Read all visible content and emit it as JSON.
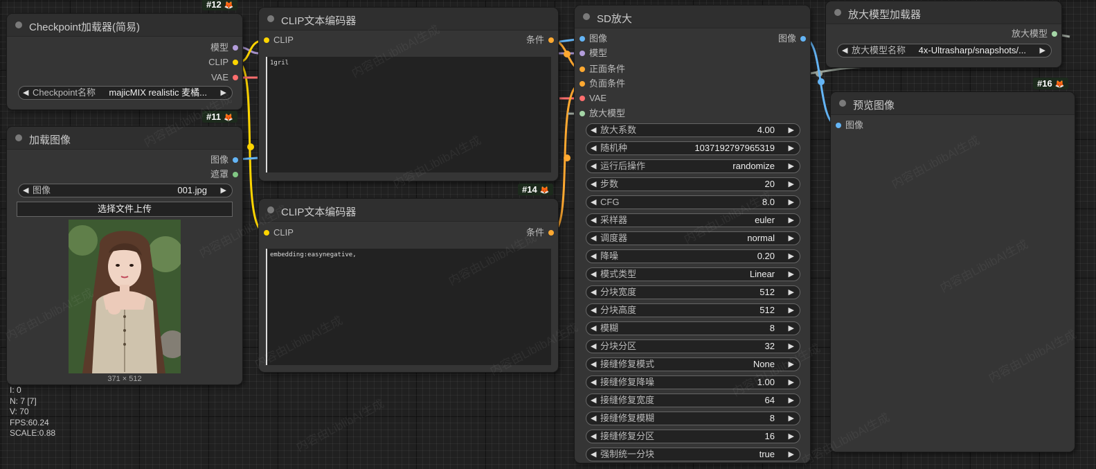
{
  "colors": {
    "model": "#b39ddb",
    "clip": "#ffd500",
    "vae": "#ff6e6e",
    "image": "#64b5f6",
    "mask": "#81c784",
    "conditioning": "#ffa931",
    "upscale_model": "#a5d6a7"
  },
  "badges": {
    "n12": "#12",
    "n11": "#11",
    "n14": "#14",
    "n16": "#16"
  },
  "checkpoint": {
    "title": "Checkpoint加载器(简易)",
    "outputs": [
      "模型",
      "CLIP",
      "VAE"
    ],
    "ckpt_label": "Checkpoint名称",
    "ckpt_value": "majicMIX realistic 麦橘..."
  },
  "load_image": {
    "title": "加载图像",
    "outputs": [
      "图像",
      "遮罩"
    ],
    "image_label": "图像",
    "image_value": "001.jpg",
    "upload_label": "选择文件上传",
    "dims": "371 × 512"
  },
  "clip_pos": {
    "title": "CLIP文本编码器",
    "input": "CLIP",
    "output": "条件",
    "text": "1gril"
  },
  "clip_neg": {
    "title": "CLIP文本编码器",
    "input": "CLIP",
    "output": "条件",
    "text": "embedding:easynegative,"
  },
  "sd_upscale": {
    "title": "SD放大",
    "inputs": [
      "图像",
      "模型",
      "正面条件",
      "负面条件",
      "VAE",
      "放大模型"
    ],
    "output": "图像",
    "widgets": [
      {
        "label": "放大系数",
        "value": "4.00"
      },
      {
        "label": "随机种",
        "value": "1037192797965319"
      },
      {
        "label": "运行后操作",
        "value": "randomize"
      },
      {
        "label": "步数",
        "value": "20"
      },
      {
        "label": "CFG",
        "value": "8.0"
      },
      {
        "label": "采样器",
        "value": "euler"
      },
      {
        "label": "调度器",
        "value": "normal"
      },
      {
        "label": "降噪",
        "value": "0.20"
      },
      {
        "label": "模式类型",
        "value": "Linear"
      },
      {
        "label": "分块宽度",
        "value": "512"
      },
      {
        "label": "分块高度",
        "value": "512"
      },
      {
        "label": "模糊",
        "value": "8"
      },
      {
        "label": "分块分区",
        "value": "32"
      },
      {
        "label": "接缝修复模式",
        "value": "None"
      },
      {
        "label": "接缝修复降噪",
        "value": "1.00"
      },
      {
        "label": "接缝修复宽度",
        "value": "64"
      },
      {
        "label": "接缝修复模糊",
        "value": "8"
      },
      {
        "label": "接缝修复分区",
        "value": "16"
      },
      {
        "label": "强制统一分块",
        "value": "true"
      }
    ]
  },
  "upscale_loader": {
    "title": "放大模型加载器",
    "output": "放大模型",
    "model_label": "放大模型名称",
    "model_value": "4x-Ultrasharp/snapshots/..."
  },
  "preview": {
    "title": "预览图像",
    "input": "图像"
  },
  "stats": [
    "I: 0",
    "N: 7 [7]",
    "V: 70",
    "FPS:60.24",
    "SCALE:0.88"
  ],
  "watermark": "内容由LiblibAI生成"
}
